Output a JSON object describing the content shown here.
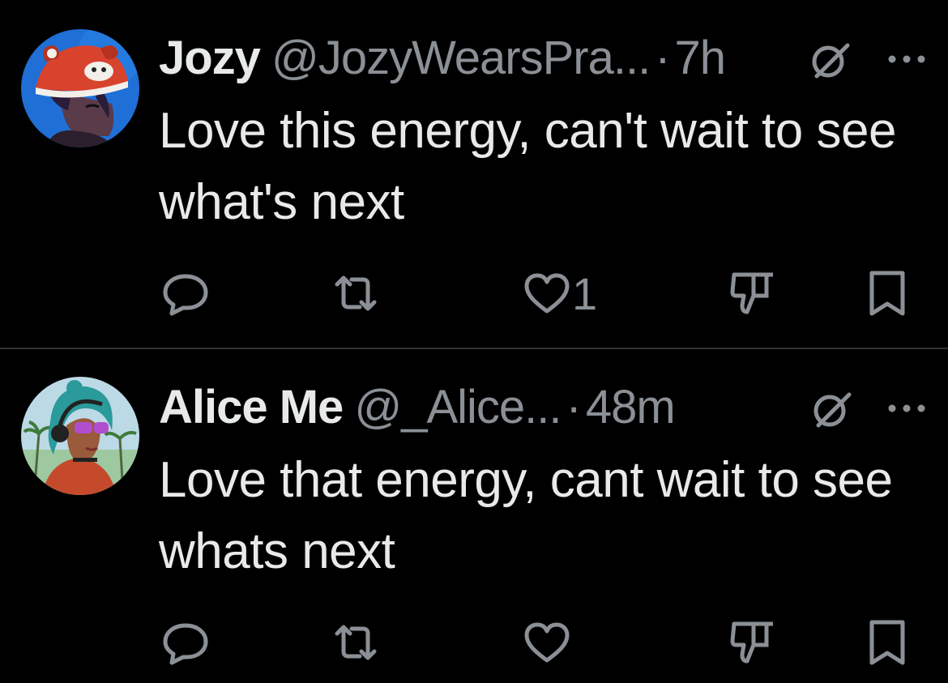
{
  "colors": {
    "background": "#000000",
    "text_primary": "#e7e9ea",
    "text_secondary": "#8b9096",
    "divider": "#2f3336"
  },
  "tweets": [
    {
      "display_name": "Jozy",
      "handle": "@JozyWearsPra...",
      "separator": "·",
      "time": "7h",
      "text": "Love this energy, can't wait to see what's next",
      "likes": "1",
      "avatar": "avatar-red-panda-hat",
      "icons": [
        "reply-icon",
        "repost-icon",
        "like-icon",
        "views-icon",
        "bookmark-icon",
        "grok-icon",
        "more-icon"
      ]
    },
    {
      "display_name": "Alice Me",
      "handle": "@_Alice...",
      "separator": "·",
      "time": "48m",
      "text": "Love that energy, cant wait to see whats next",
      "likes": "",
      "avatar": "avatar-teal-hair-sunglasses",
      "icons": [
        "reply-icon",
        "repost-icon",
        "like-icon",
        "views-icon",
        "bookmark-icon",
        "grok-icon",
        "more-icon"
      ]
    }
  ]
}
